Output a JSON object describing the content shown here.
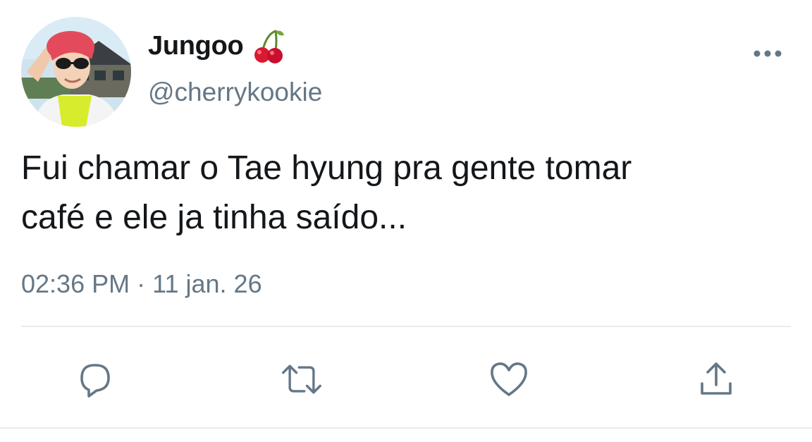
{
  "tweet": {
    "display_name": "Jungoo",
    "display_name_emoji": "cherry-emoji",
    "handle": "@cherrykookie",
    "text_lines": [
      "Fui chamar o Tae hyung pra gente tomar",
      "café e ele ja tinha saído..."
    ],
    "time": "02:36 PM",
    "separator": "·",
    "date": "11 jan. 26"
  },
  "actions": [
    {
      "icon": "reply-icon"
    },
    {
      "icon": "retweet-icon"
    },
    {
      "icon": "like-icon"
    },
    {
      "icon": "share-icon"
    }
  ],
  "colors": {
    "text": "#14171a",
    "secondary": "#657786",
    "icon": "#657786",
    "divider": "#e6ecf0"
  }
}
